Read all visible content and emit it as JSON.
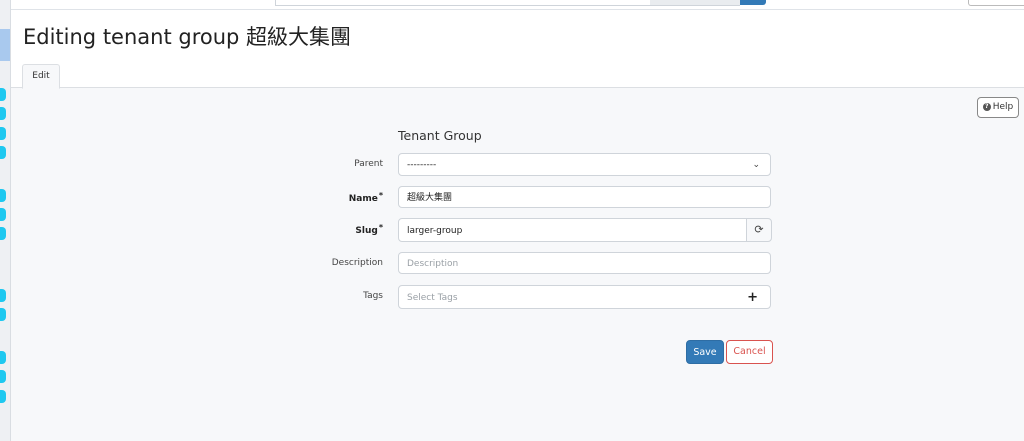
{
  "header": {
    "title": "Editing tenant group 超級大集團"
  },
  "tabs": [
    {
      "label": "Edit"
    }
  ],
  "help": {
    "label": "Help"
  },
  "form": {
    "section_title": "Tenant Group",
    "parent": {
      "label": "Parent",
      "value": "---------"
    },
    "name": {
      "label": "Name",
      "value": "超級大集團",
      "required": true
    },
    "slug": {
      "label": "Slug",
      "value": "larger-group",
      "required": true
    },
    "description": {
      "label": "Description",
      "placeholder": "Description"
    },
    "tags": {
      "label": "Tags",
      "placeholder": "Select Tags"
    }
  },
  "actions": {
    "save_label": "Save",
    "cancel_label": "Cancel"
  },
  "colors": {
    "primary": "#337ab7",
    "danger": "#d9534f",
    "sidebar_accent": "#1ec8f0"
  }
}
